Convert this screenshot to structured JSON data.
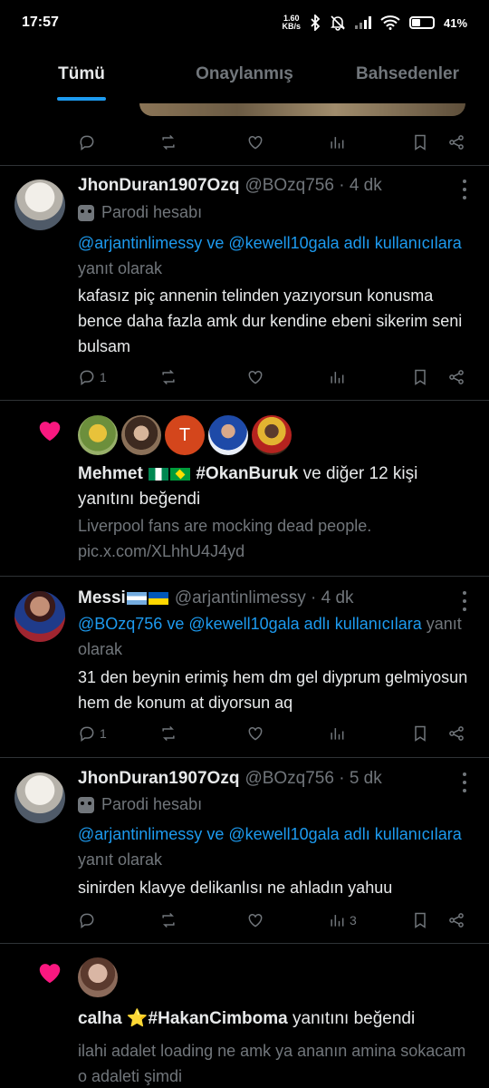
{
  "status": {
    "time": "17:57",
    "net_speed": "1.60",
    "net_unit": "KB/s",
    "battery": "41",
    "battery_level": 0.41
  },
  "tabs": [
    {
      "label": "Tümü",
      "active": true
    },
    {
      "label": "Onaylanmış",
      "active": false
    },
    {
      "label": "Bahsedenler",
      "active": false
    }
  ],
  "posts": [
    {
      "name": "JhonDuran1907Ozq",
      "handle": "@BOzq756 · 4 dk",
      "parody": "Parodi hesabı",
      "reply_links": "@arjantinlimessy ve @kewell10gala adlı kullanıcılara",
      "reply_suffix": "yanıt olarak",
      "text": "kafasız piç annenin telinden yazıyorsun konusma bence daha fazla amk dur kendine ebeni sikerim seni bulsam",
      "reply_count": "1",
      "views": ""
    },
    {
      "name": "Messi",
      "handle": "@arjantinlimessy · 4 dk",
      "reply_links": "@BOzq756 ve @kewell10gala adlı kullanıcılara",
      "reply_suffix": "yanıt olarak",
      "text": "31 den beynin erimiş hem dm gel diyprum gelmiyosun hem de konum at diyorsun aq",
      "reply_count": "1",
      "views": ""
    },
    {
      "name": "JhonDuran1907Ozq",
      "handle": "@BOzq756 · 5 dk",
      "parody": "Parodi hesabı",
      "reply_links": "@arjantinlimessy ve @kewell10gala adlı kullanıcılara",
      "reply_suffix": "yanıt olarak",
      "text": "sinirden klavye delikanlısı ne ahladın yahuu",
      "reply_count": "",
      "views": "3"
    }
  ],
  "like_notifs": [
    {
      "first": "Mehmet",
      "tag": "#OkanBuruk",
      "rest": "ve diğer 12 kişi yanıtını beğendi",
      "preview": "Liverpool fans are mocking dead people. pic.x.com/XLhhU4J4yd",
      "letter_avatar": "T"
    },
    {
      "first": "calha",
      "star": "⭐",
      "tag": "#HakanCimboma",
      "rest": "yanıtını beğendi",
      "preview": "ilahi adalet loading ne amk ya ananın amina sokacam o adaleti şimdi"
    }
  ],
  "colors": {
    "accent": "#1d9bf0",
    "like": "#f91880",
    "muted": "#71767b",
    "bg": "#000000"
  }
}
